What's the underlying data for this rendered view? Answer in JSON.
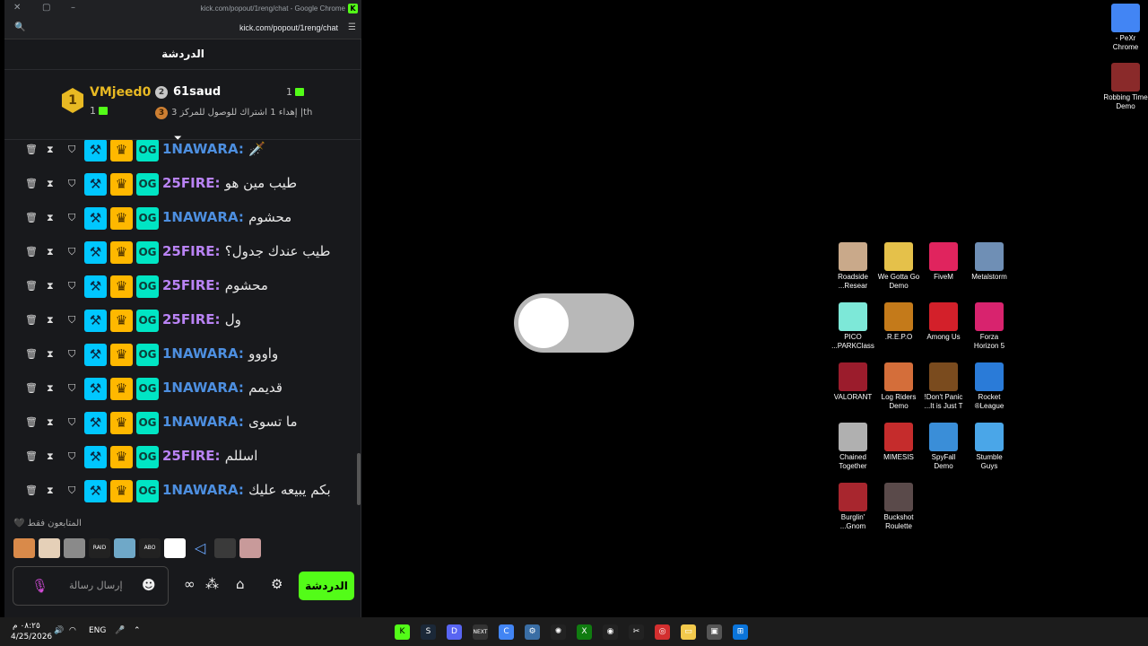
{
  "window": {
    "title": "kick.com/popout/1reng/chat - Google Chrome",
    "url": "kick.com/popout/1reng/chat"
  },
  "chat": {
    "header_title": "الدردشة",
    "leaderboard": {
      "first": {
        "rank": "1",
        "name": "VMjeed0",
        "count": "1"
      },
      "second": {
        "rank": "2",
        "name": "61saud",
        "count": "1"
      },
      "third": {
        "rank": "3",
        "text": "إهداء 1 اشتراك للوصول للمركز 3 |th"
      }
    },
    "messages": [
      {
        "user": "1NAWARA",
        "text": "🗡️",
        "color": "#4d8fe0"
      },
      {
        "user": "25FIRE",
        "text": "طيب مين هو",
        "color": "#b983f5"
      },
      {
        "user": "1NAWARA",
        "text": "محشوم",
        "color": "#4d8fe0"
      },
      {
        "user": "25FIRE",
        "text": "طيب عندك جدول؟",
        "color": "#b983f5"
      },
      {
        "user": "25FIRE",
        "text": "محشوم",
        "color": "#b983f5"
      },
      {
        "user": "25FIRE",
        "text": "ول",
        "color": "#b983f5"
      },
      {
        "user": "1NAWARA",
        "text": "واووو",
        "color": "#4d8fe0"
      },
      {
        "user": "1NAWARA",
        "text": "قديمم",
        "color": "#4d8fe0"
      },
      {
        "user": "1NAWARA",
        "text": "ما تسوى",
        "color": "#4d8fe0"
      },
      {
        "user": "25FIRE",
        "text": "اسللم",
        "color": "#b983f5"
      },
      {
        "user": "1NAWARA",
        "text": "بكم يبيعه عليك",
        "color": "#4d8fe0"
      }
    ],
    "followers_only_label": "المتابعون فقط",
    "input_placeholder": "إرسال رسالة",
    "send_label": "الدردشة"
  },
  "toggle": {
    "state": "off"
  },
  "desktop_icons": [
    {
      "label": "- PeXr Chrome",
      "color": "#4285f4"
    },
    {
      "label": "Robbing Time Demo",
      "color": "#8a2a2a"
    },
    {
      "label": "Roadside ...Resear",
      "color": "#c9a98a"
    },
    {
      "label": "We Gotta Go Demo",
      "color": "#e5c14a"
    },
    {
      "label": "FiveM",
      "color": "#e0245e"
    },
    {
      "label": "Metalstorm",
      "color": "#6f8fb5"
    },
    {
      "label": "PICO ...PARKClass",
      "color": "#7de8d8"
    },
    {
      "label": ".R.E.P.O",
      "color": "#c47a1a"
    },
    {
      "label": "Among Us",
      "color": "#d3202a"
    },
    {
      "label": "Forza Horizon 5",
      "color": "#d8236e"
    },
    {
      "label": "VALORANT",
      "color": "#9b1c2c"
    },
    {
      "label": "Log Riders Demo",
      "color": "#d46e3a"
    },
    {
      "label": "!Don't Panic ...It is Just T",
      "color": "#7a4b1e"
    },
    {
      "label": "Rocket ®League",
      "color": "#2a7bd8"
    },
    {
      "label": "Chained Together",
      "color": "#b0b0b0"
    },
    {
      "label": "MIMESIS",
      "color": "#c52c2c"
    },
    {
      "label": "SpyFall Demo",
      "color": "#3a8ed8"
    },
    {
      "label": "Stumble Guys",
      "color": "#4aa6e8"
    },
    {
      "label": "Burglin' ...Gnom",
      "color": "#a8262e"
    },
    {
      "label": "Buckshot Roulette",
      "color": "#5a4a4a"
    }
  ],
  "taskbar": {
    "time": "٠٨:٢٥ م",
    "date": "4/25/2026",
    "lang": "ENG"
  }
}
